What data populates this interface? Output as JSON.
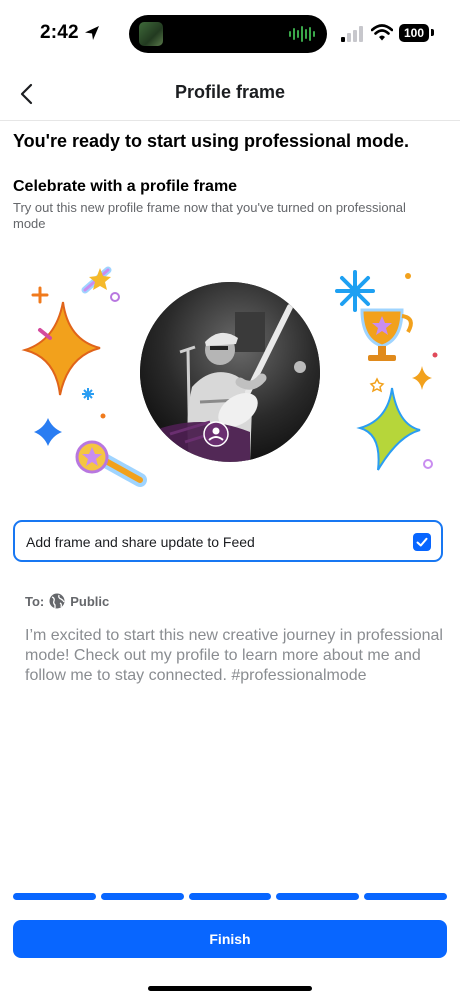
{
  "status_bar": {
    "time": "2:42",
    "battery": "100",
    "icons": [
      "location-arrow-icon",
      "signal-icon",
      "wifi-icon",
      "battery-icon"
    ]
  },
  "header": {
    "title": "Profile frame",
    "back_icon": "chevron-left-icon"
  },
  "headline": "You're ready to start using professional mode.",
  "section": {
    "title": "Celebrate with a profile frame",
    "description": "Try out this new profile frame now that you've turned on professional mode"
  },
  "frame_option": {
    "label": "Add frame and share update to Feed",
    "checked": true
  },
  "audience": {
    "to_label": "To:",
    "value": "Public",
    "icon": "globe-icon"
  },
  "post_text": "I’m excited to start this new creative journey in professional mode! Check out my profile to learn more about me and follow me to stay connected. #professionalmode",
  "progress": {
    "segments": 5,
    "completed": 5
  },
  "finish_label": "Finish",
  "colors": {
    "accent": "#0866ff",
    "border_blue": "#1877f2",
    "secondary_text": "#65676b",
    "placeholder_text": "#8a8d91"
  }
}
